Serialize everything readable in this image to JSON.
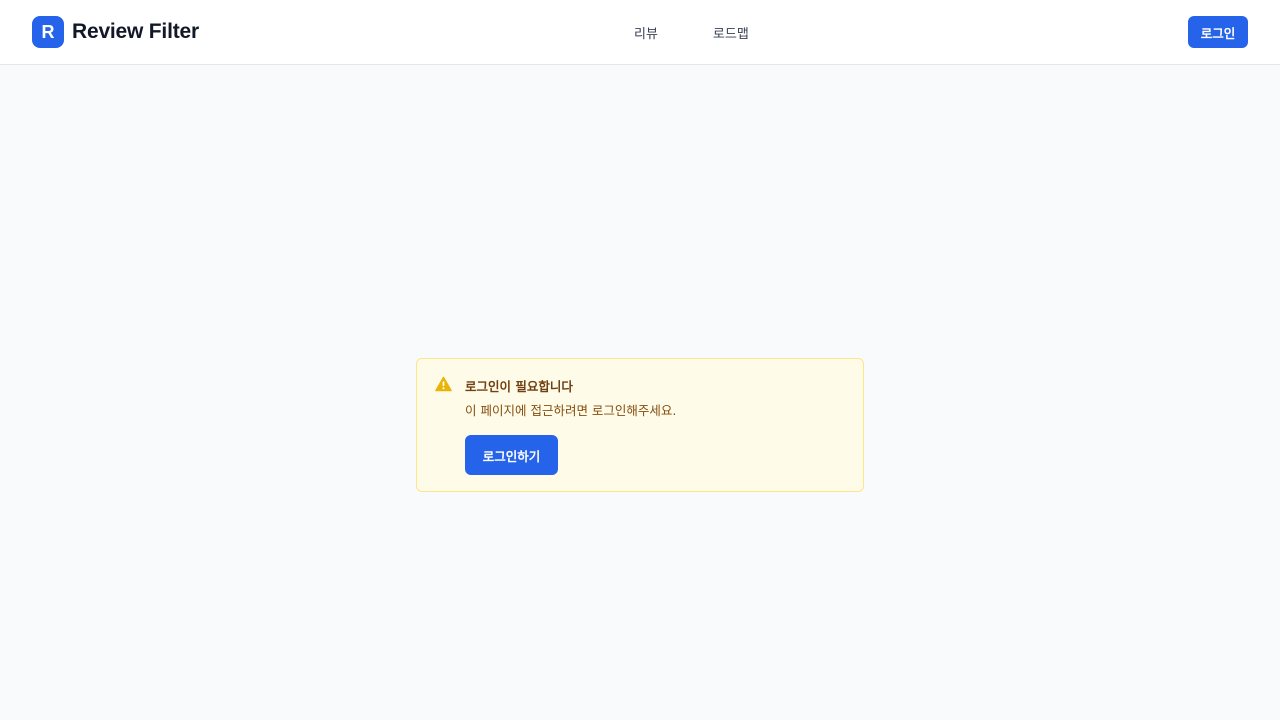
{
  "header": {
    "logo_mark": "R",
    "logo_text": "Review Filter",
    "nav": [
      {
        "label": "리뷰"
      },
      {
        "label": "로드맵"
      }
    ],
    "login_label": "로그인"
  },
  "alert": {
    "icon": "warning-icon",
    "title": "로그인이 필요합니다",
    "message": "이 페이지에 접근하려면 로그인해주세요.",
    "button_label": "로그인하기"
  },
  "colors": {
    "primary": "#2563eb",
    "page_background": "#f8fafc",
    "alert_background": "#fefce8",
    "alert_border": "#fde68a",
    "warning_icon": "#eab308",
    "alert_text": "#854d0e"
  }
}
